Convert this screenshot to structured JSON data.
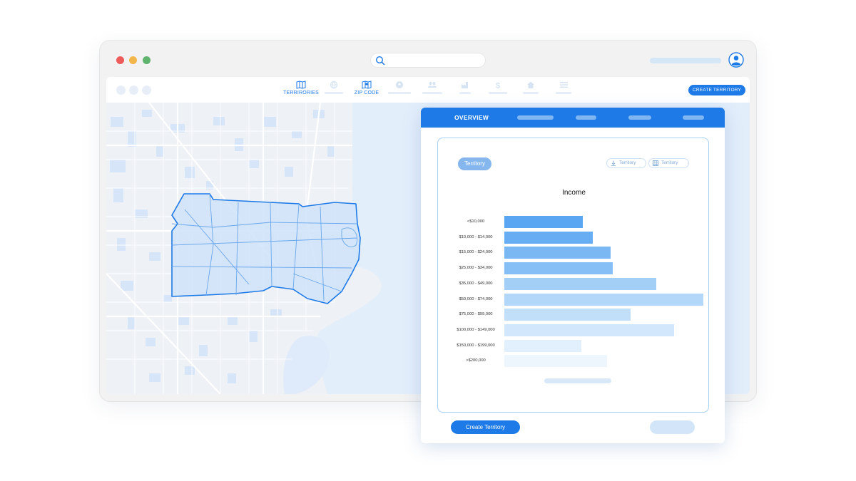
{
  "window": {
    "dots": [
      "#ee5b5b",
      "#f2b64a",
      "#5fb36c"
    ],
    "accent": "#1d7ae6"
  },
  "nav": {
    "items": [
      {
        "label": "TERRIRORIES",
        "icon": "map-icon",
        "active": true
      },
      {
        "label": "",
        "icon": "globe-icon",
        "active": false
      },
      {
        "label": "ZIP CODE",
        "icon": "zip-map-icon",
        "active": true
      },
      {
        "label": "",
        "icon": "pin-icon",
        "active": false
      },
      {
        "label": "",
        "icon": "people-icon",
        "active": false
      },
      {
        "label": "",
        "icon": "factory-icon",
        "active": false
      },
      {
        "label": "",
        "icon": "dollar-icon",
        "active": false
      },
      {
        "label": "",
        "icon": "home-icon",
        "active": false
      },
      {
        "label": "",
        "icon": "list-icon",
        "active": false
      }
    ],
    "create_territory": "CREATE TERRITORY"
  },
  "card": {
    "tabs": [
      "OVERVIEW"
    ],
    "territory_chip": "Territory",
    "filter_chips": [
      {
        "label": "Territory",
        "icon": "download-icon"
      },
      {
        "label": "Territory",
        "icon": "table-icon"
      }
    ],
    "create_button": "Create Territory"
  },
  "chart_data": {
    "type": "bar",
    "orientation": "horizontal",
    "title": "Income",
    "categories": [
      "<$10,000",
      "$10,000 - $14,000",
      "$15,000 - $24,000",
      "$25,000 - $34,000",
      "$35,000 - $49,000",
      "$50,000 - $74,000",
      "$75,000 - $99,000",
      "$100,000 - $149,000",
      "$150,000 - $199,000",
      ">$200,000"
    ],
    "values": [
      40,
      45,
      54,
      55,
      77,
      101,
      64,
      86,
      39,
      52
    ],
    "colors": [
      "#5aa6f2",
      "#67adf3",
      "#7ab8f4",
      "#86bff5",
      "#a3cff7",
      "#b3d7f8",
      "#c2dff9",
      "#d2e7fb",
      "#e2effc",
      "#edf5fd"
    ],
    "xlim": [
      0,
      101
    ],
    "grid": false
  }
}
